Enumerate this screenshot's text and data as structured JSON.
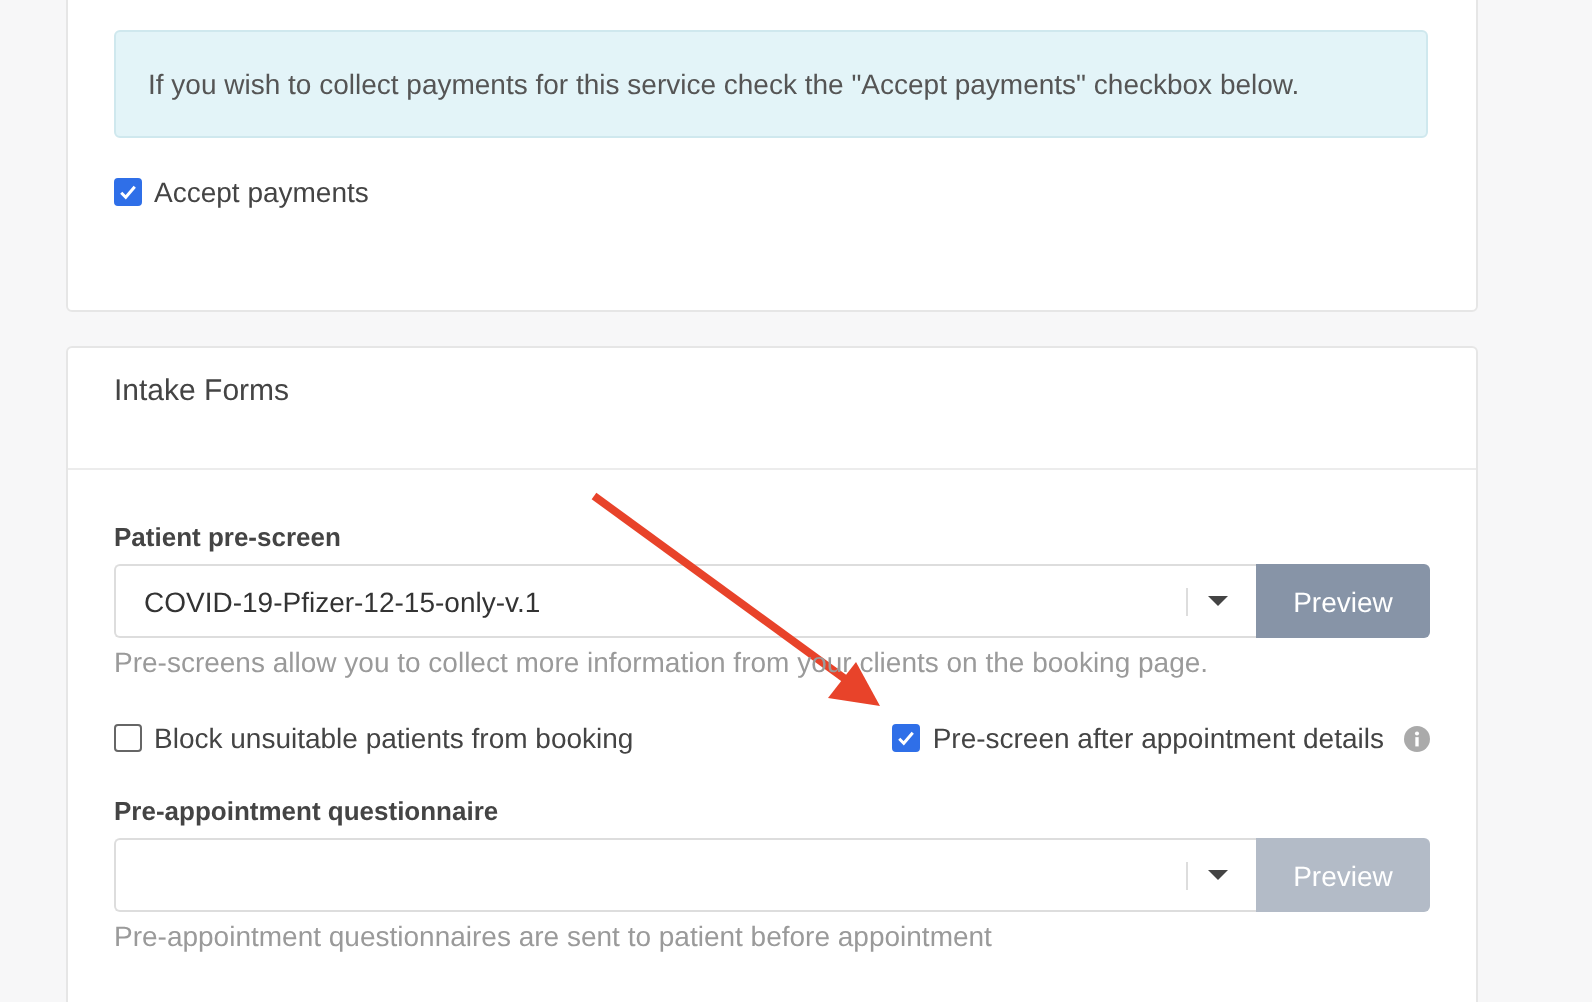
{
  "payments_card": {
    "notice": "If you wish to collect payments for this service check the \"Accept payments\" checkbox below.",
    "checkbox": {
      "label": "Accept payments",
      "checked": true
    }
  },
  "intake_forms": {
    "title": "Intake Forms",
    "fields": [
      {
        "label": "Patient pre-screen",
        "value": "COVID-19-Pfizer-12-15-only-v.1",
        "button": {
          "label": "Preview",
          "disabled": false
        },
        "help": "Pre-screens allow you to collect more information from your clients on the booking page.",
        "options": [
          {
            "label": "Block unsuitable patients from booking",
            "checked": false,
            "info": false
          },
          {
            "label": "Pre-screen after appointment details",
            "checked": true,
            "info": true
          }
        ]
      },
      {
        "label": "Pre-appointment questionnaire",
        "button": {
          "label": "Preview",
          "disabled": true
        },
        "help": "Pre-appointment questionnaires are sent to patient before appointment"
      }
    ]
  }
}
